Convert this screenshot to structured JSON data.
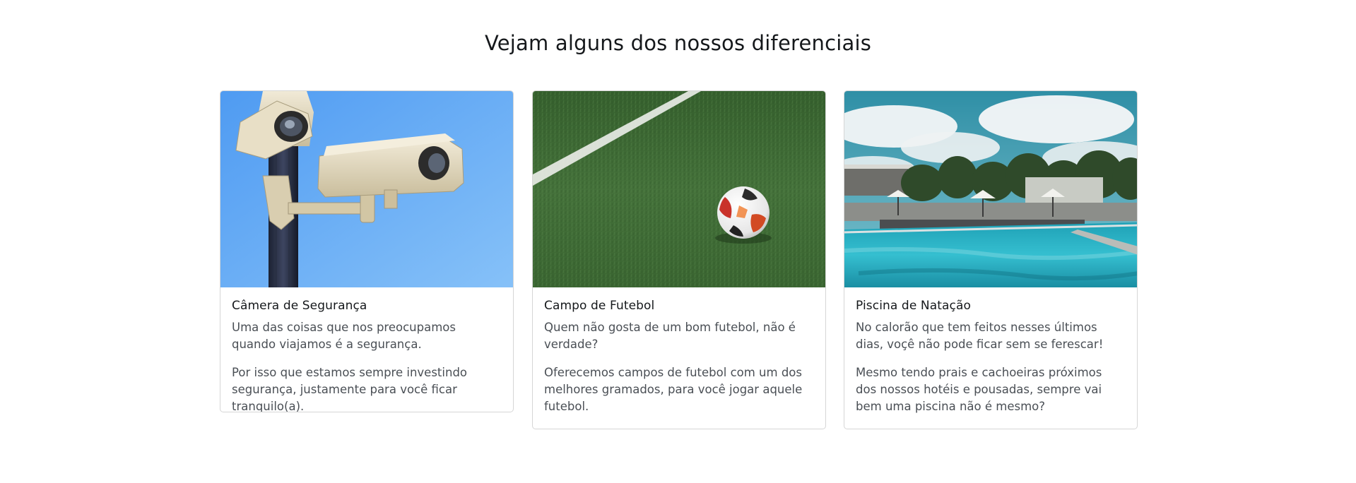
{
  "section": {
    "title": "Vejam alguns dos nossos diferenciais"
  },
  "cards": [
    {
      "image": "security-camera-photo",
      "title": "Câmera de Segurança",
      "paragraphs": [
        "Uma das coisas que nos preocupamos quando viajamos é a segurança.",
        "Por isso que estamos sempre investindo segurança, justamente para você ficar tranquilo(a)."
      ]
    },
    {
      "image": "soccer-field-photo",
      "title": "Campo de Futebol",
      "paragraphs": [
        "Quem não gosta de um bom futebol, não é verdade?",
        "Oferecemos campos de futebol com um dos melhores gramados, para você jogar aquele futebol."
      ]
    },
    {
      "image": "swimming-pool-photo",
      "title": "Piscina de Natação",
      "paragraphs": [
        "No calorão que tem feitos nesses últimos dias, voçê não pode ficar sem se ferescar!",
        "Mesmo tendo prais e cachoeiras próximos dos nossos hotéis e pousadas, sempre vai bem uma piscina não é mesmo?"
      ]
    }
  ],
  "colors": {
    "sky_blue": "#5aa6f0",
    "grass_green": "#3f6b34",
    "pool_cyan": "#2fb3c4"
  }
}
